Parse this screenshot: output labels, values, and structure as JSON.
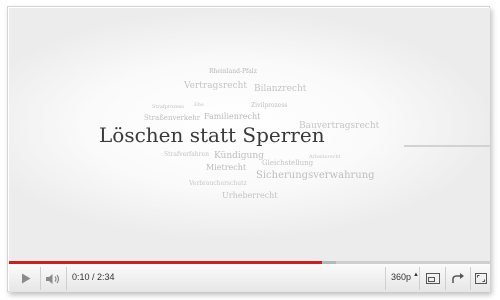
{
  "video": {
    "title": "Löschen statt Sperren",
    "cloud_words": [
      "Rheinland-Pfalz",
      "Vertragsrecht",
      "Bilanzrecht",
      "Strafprozess",
      "Zivilprozess",
      "Ehe",
      "Straßenverkehr",
      "Familienrecht",
      "Bauvertragsrecht",
      "Strafverfahren",
      "Kündigung",
      "Arbeitsrecht",
      "Gleichstellung",
      "Sicherungsverwahrung",
      "Mietrecht",
      "Verbraucherschutz",
      "Urheberrecht"
    ]
  },
  "controls": {
    "current_time": "0:10",
    "duration": "2:34",
    "time_separator": " / ",
    "quality": "360p",
    "progress_fraction": 0.65,
    "buffered_fraction": 0.68
  },
  "colors": {
    "progress": "#cc1f1f",
    "control_bar": "#eeeeee"
  },
  "icons": {
    "play": "play-icon",
    "volume": "volume-icon",
    "quality_caret": "caret-up-icon",
    "popout": "popout-icon",
    "share": "share-icon",
    "fullscreen": "fullscreen-icon"
  }
}
